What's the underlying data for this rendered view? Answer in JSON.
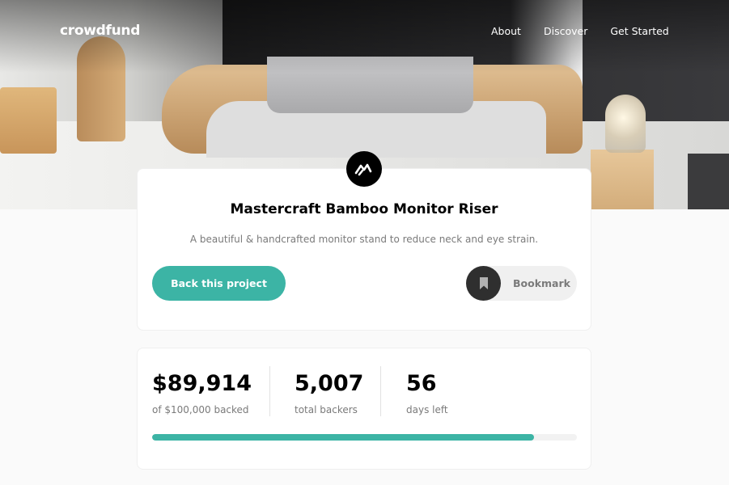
{
  "header": {
    "logo": "crowdfund",
    "nav": [
      "About",
      "Discover",
      "Get Started"
    ]
  },
  "project": {
    "title": "Mastercraft Bamboo Monitor Riser",
    "description": "A beautiful & handcrafted monitor stand to reduce neck and eye strain.",
    "back_label": "Back this project",
    "bookmark_label": "Bookmark"
  },
  "stats": {
    "backed": {
      "value": "$89,914",
      "label": "of $100,000 backed"
    },
    "backers": {
      "value": "5,007",
      "label": "total backers"
    },
    "days": {
      "value": "56",
      "label": "days left"
    },
    "progress_percent": 89.914
  },
  "icons": {
    "brand": "mastercraft-logo-icon",
    "bookmark": "bookmark-icon"
  },
  "colors": {
    "accent": "#3cb4a5",
    "dark": "#2f2f2f",
    "muted": "#7a7a7a"
  }
}
